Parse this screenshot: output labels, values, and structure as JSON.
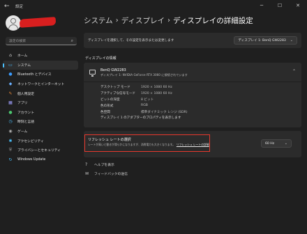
{
  "window": {
    "title": "設定",
    "back_icon": "back-arrow-icon",
    "controls": [
      "minimize-icon",
      "maximize-icon",
      "close-icon"
    ]
  },
  "sidebar": {
    "search_placeholder": "設定の検索",
    "items": [
      {
        "label": "ホーム",
        "icon": "home-icon"
      },
      {
        "label": "システム",
        "icon": "system-icon",
        "active": true
      },
      {
        "label": "Bluetooth とデバイス",
        "icon": "bluetooth-icon"
      },
      {
        "label": "ネットワークとインターネット",
        "icon": "network-icon"
      },
      {
        "label": "個人用設定",
        "icon": "brush-icon"
      },
      {
        "label": "アプリ",
        "icon": "apps-icon"
      },
      {
        "label": "アカウント",
        "icon": "account-icon"
      },
      {
        "label": "時刻と言語",
        "icon": "clock-icon"
      },
      {
        "label": "ゲーム",
        "icon": "game-icon"
      },
      {
        "label": "アクセシビリティ",
        "icon": "accessibility-icon"
      },
      {
        "label": "プライバシーとセキュリティ",
        "icon": "shield-icon"
      },
      {
        "label": "Windows Update",
        "icon": "update-icon"
      }
    ]
  },
  "breadcrumb": {
    "items": [
      "システム",
      "ディスプレイ",
      "ディスプレイの詳細設定"
    ],
    "separator": "›"
  },
  "display_select": {
    "label": "ディスプレイを選択して、その設定を表示または変更します",
    "value": "ディスプレイ 1: BenQ GW2283"
  },
  "section_title": "ディスプレイの情報",
  "monitor": {
    "name": "BenQ GW2283",
    "subtitle": "ディスプレイ 1: NVIDIA GeForce RTX 3060 に接続されています",
    "properties": [
      {
        "key": "デスクトップ モード",
        "value": "1920 × 1080 60 Hz"
      },
      {
        "key": "アクティブな信号モード",
        "value": "1920 × 1080 60 Hz"
      },
      {
        "key": "ビットの深度",
        "value": "8 ビット"
      },
      {
        "key": "色の形式",
        "value": "RGB"
      },
      {
        "key": "色空間",
        "value": "標準ダイナミック レンジ (SDR)"
      }
    ],
    "adapter_link": "ディスプレイ 1 のアダプターのプロパティを表示します"
  },
  "refresh": {
    "title": "リフレッシュ レートの選択",
    "description": "レートが高いと動きが滑らかになりますが、消費電力も大きくなります。",
    "link": "リフレッシュ レートの詳細",
    "value": "60 Hz"
  },
  "help_links": [
    {
      "label": "ヘルプを表示",
      "icon": "help-icon"
    },
    {
      "label": "フィードバックの送信",
      "icon": "feedback-icon"
    }
  ],
  "colors": {
    "accent": "#4cc2ff",
    "highlight": "#e8382c",
    "redaction": "#d81f1f"
  }
}
